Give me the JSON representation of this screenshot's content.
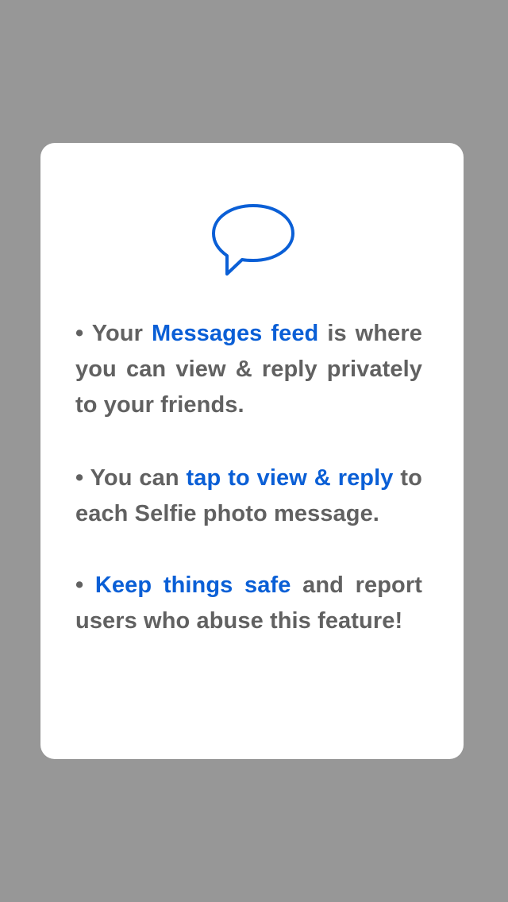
{
  "colors": {
    "background": "#979797",
    "card": "#ffffff",
    "body_text": "#616161",
    "accent": "#0a5fd6"
  },
  "icon": "speech-bubble-icon",
  "tips": [
    {
      "bullet": "•",
      "before": "Your",
      "highlight": "Messages feed",
      "after": "is where you can view & reply privately to your friends."
    },
    {
      "bullet": "•",
      "before": "You can",
      "highlight": "tap to view & reply",
      "after": "to each Selfie photo message."
    },
    {
      "bullet": "•",
      "before": "",
      "highlight": "Keep things safe",
      "after": "and report users who abuse this feature!"
    }
  ]
}
